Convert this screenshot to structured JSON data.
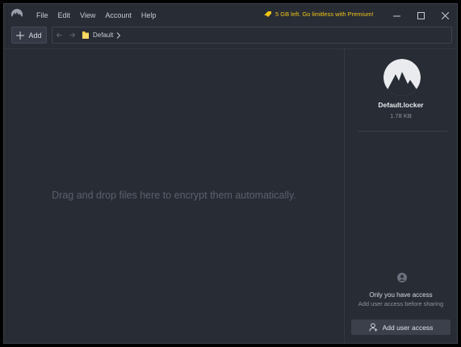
{
  "menu": {
    "items": [
      "File",
      "Edit",
      "View",
      "Account",
      "Help"
    ]
  },
  "promo": {
    "text": "5 GB left. Go limitless with Premium!",
    "icon": "tag-icon",
    "color": "#f0c419"
  },
  "toolbar": {
    "add_label": "Add"
  },
  "breadcrumb": {
    "folder": "Default"
  },
  "dropzone": {
    "message": "Drag and drop files here to encrypt them automatically."
  },
  "locker": {
    "name": "Default.locker",
    "size": "1.78 KB"
  },
  "access": {
    "title": "Only you have access",
    "subtitle": "Add user access before sharing",
    "button_label": "Add user access"
  }
}
